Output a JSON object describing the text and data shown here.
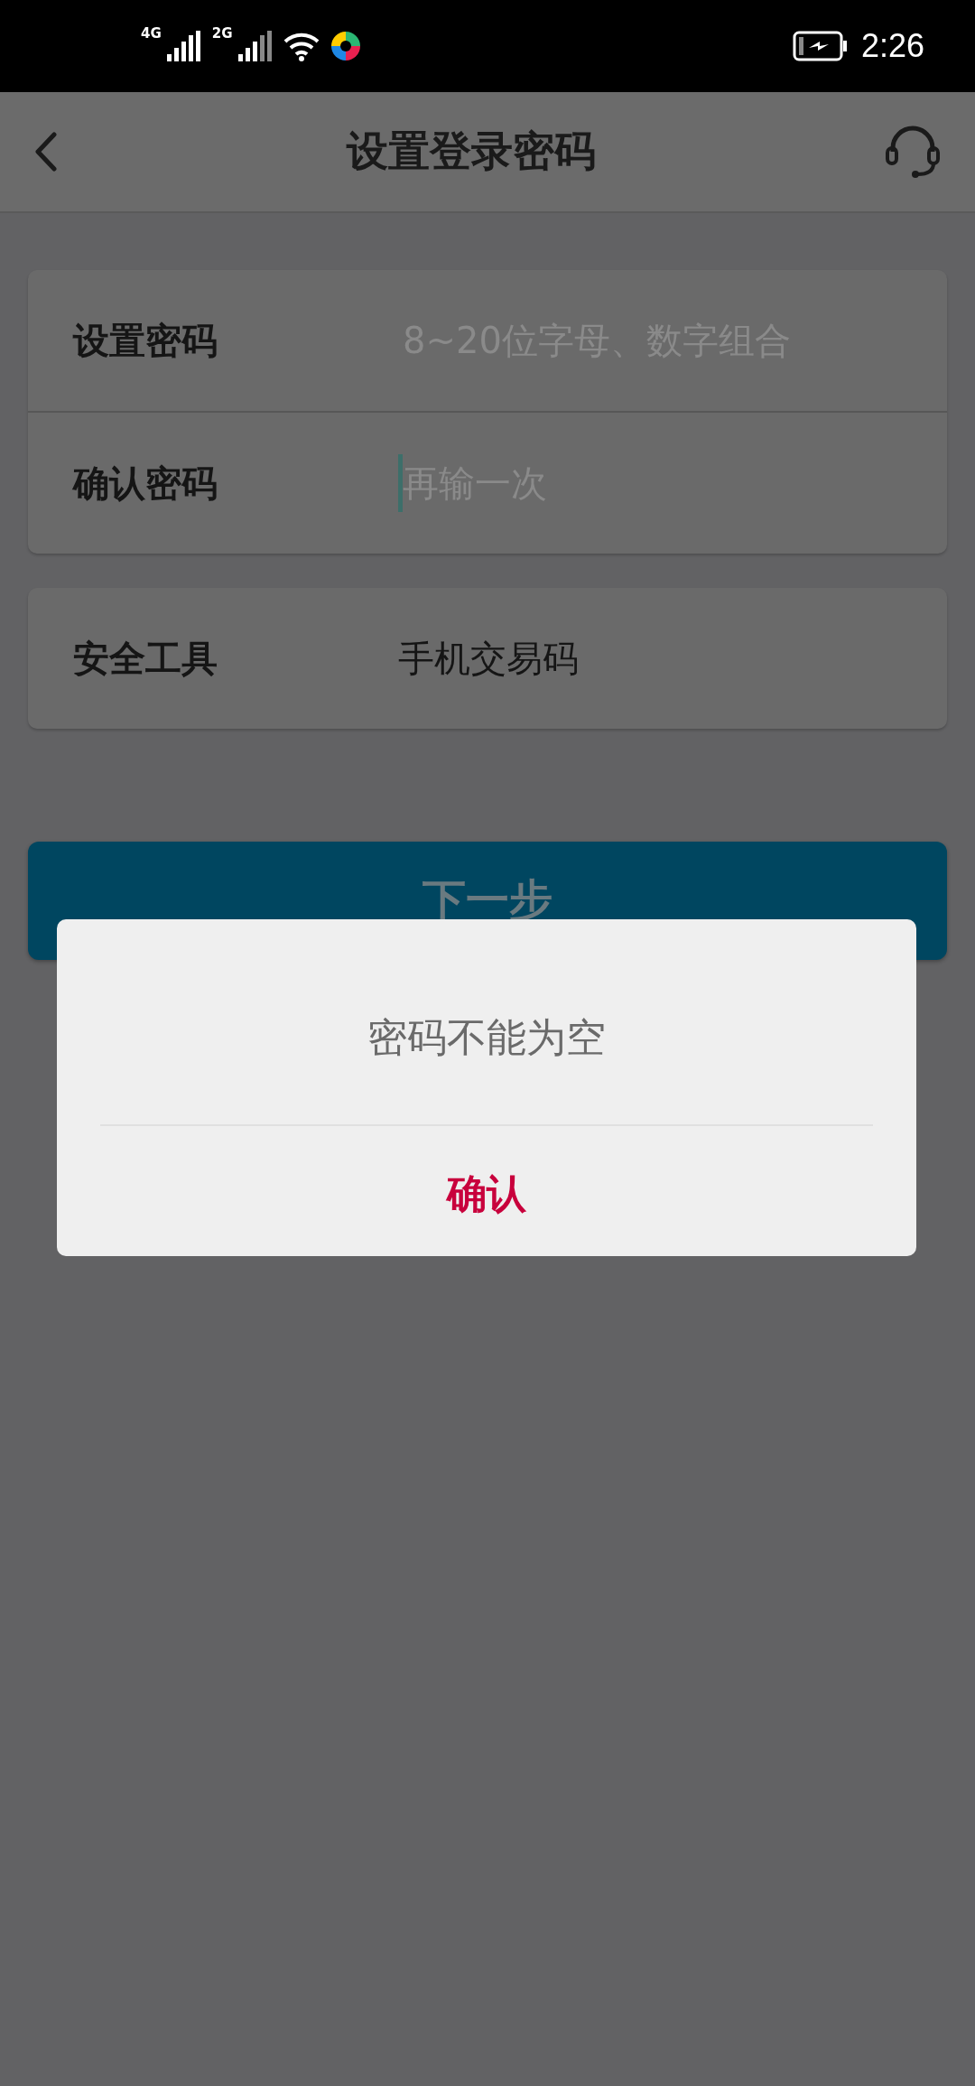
{
  "status_bar": {
    "network_1": "4G",
    "network_2": "2G",
    "time": "2:26"
  },
  "header": {
    "title": "设置登录密码"
  },
  "form": {
    "fields": [
      {
        "label": "设置密码",
        "placeholder": "8~20位字母、数字组合",
        "focused": false
      },
      {
        "label": "确认密码",
        "placeholder": "再输一次",
        "focused": true
      }
    ]
  },
  "security": {
    "label": "安全工具",
    "value": "手机交易码"
  },
  "next_button": {
    "label": "下一步"
  },
  "dialog": {
    "message": "密码不能为空",
    "confirm": "确认"
  }
}
